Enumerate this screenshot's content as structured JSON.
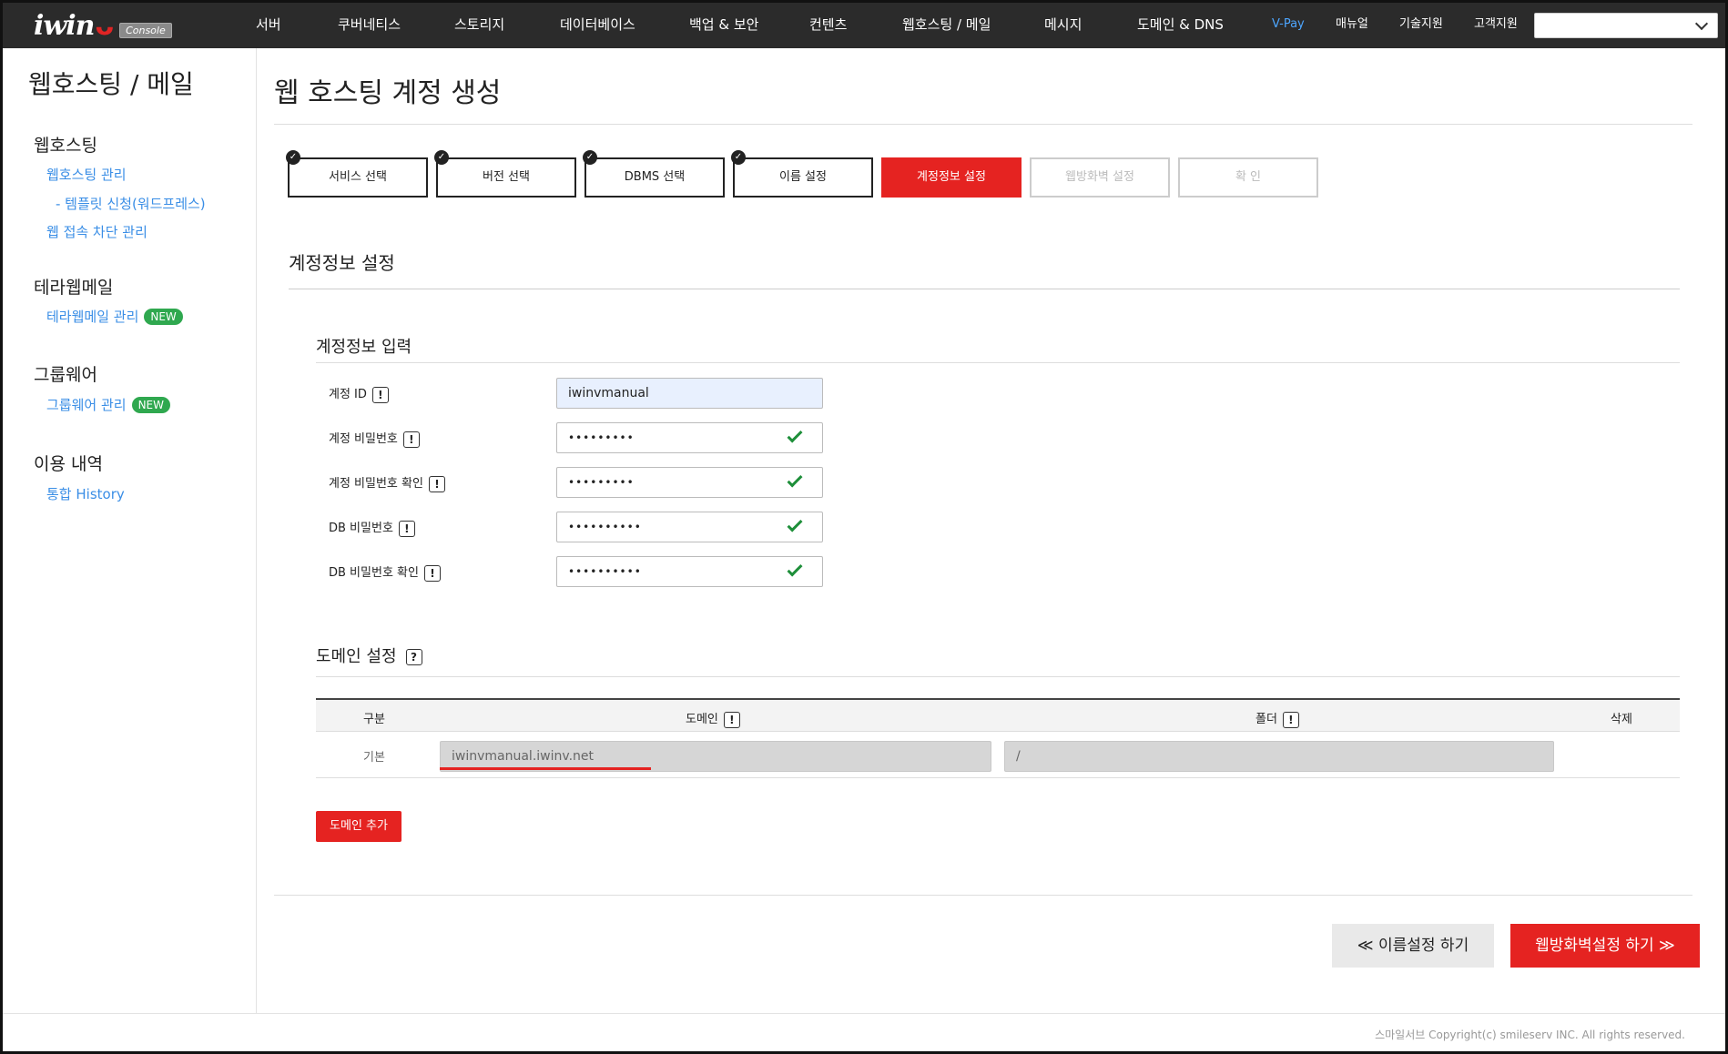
{
  "brand": {
    "logo": "iwin",
    "badge": "Console"
  },
  "nav": {
    "items": [
      "서버",
      "쿠버네티스",
      "스토리지",
      "데이터베이스",
      "백업 & 보안",
      "컨텐츠",
      "웹호스팅 / 메일",
      "메시지",
      "도메인 & DNS"
    ],
    "vpay": "V-Pay",
    "manual": "매뉴얼",
    "tech": "기술지원",
    "support": "고객지원",
    "select_value": ""
  },
  "sidebar": {
    "title": "웹호스팅 / 메일",
    "sections": [
      {
        "title": "웹호스팅",
        "links": [
          "웹호스팅 관리",
          "- 템플릿 신청(워드프레스)",
          "웹 접속 차단 관리"
        ]
      },
      {
        "title": "테라웹메일",
        "links": [
          "테라웹메일 관리"
        ],
        "badge": "NEW"
      },
      {
        "title": "그룹웨어",
        "links": [
          "그룹웨어 관리"
        ],
        "badge": "NEW"
      },
      {
        "title": "이용 내역",
        "links": [
          "통합 History"
        ]
      }
    ]
  },
  "page_title": "웹 호스팅 계정 생성",
  "steps": [
    {
      "label": "서비스 선택",
      "state": "done"
    },
    {
      "label": "버전 선택",
      "state": "done"
    },
    {
      "label": "DBMS 선택",
      "state": "done"
    },
    {
      "label": "이름 설정",
      "state": "done"
    },
    {
      "label": "계정정보 설정",
      "state": "active"
    },
    {
      "label": "웹방화벽 설정",
      "state": "disabled"
    },
    {
      "label": "확  인",
      "state": "disabled"
    }
  ],
  "section_title": "계정정보 설정",
  "account": {
    "subtitle": "계정정보 입력",
    "fields": [
      {
        "label": "계정 ID",
        "value": "iwinvmanual"
      },
      {
        "label": "계정 비밀번호",
        "value": "•••••••••"
      },
      {
        "label": "계정 비밀번호 확인",
        "value": "•••••••••"
      },
      {
        "label": "DB 비밀번호",
        "value": "••••••••••"
      },
      {
        "label": "DB 비밀번호 확인",
        "value": "••••••••••"
      }
    ],
    "info_glyph": "!"
  },
  "domain": {
    "subtitle": "도메인 설정",
    "help_glyph": "?",
    "headers": {
      "type": "구분",
      "domain": "도메인",
      "folder": "폴더",
      "delete": "삭제"
    },
    "row": {
      "type": "기본",
      "domain": "iwinvmanual.iwinv.net",
      "folder": "/"
    },
    "add_button": "도메인 추가"
  },
  "buttons": {
    "prev": "≪ 이름설정 하기",
    "next": "웹방화벽설정 하기 ≫"
  },
  "footer": {
    "copyright": "스마일서브 Copyright(c) smileserv INC. All rights reserved."
  },
  "colors": {
    "accent": "#e52321",
    "link": "#3a8ee6",
    "new_badge": "#2fa84f",
    "nav_bg": "#2b2b2b"
  }
}
